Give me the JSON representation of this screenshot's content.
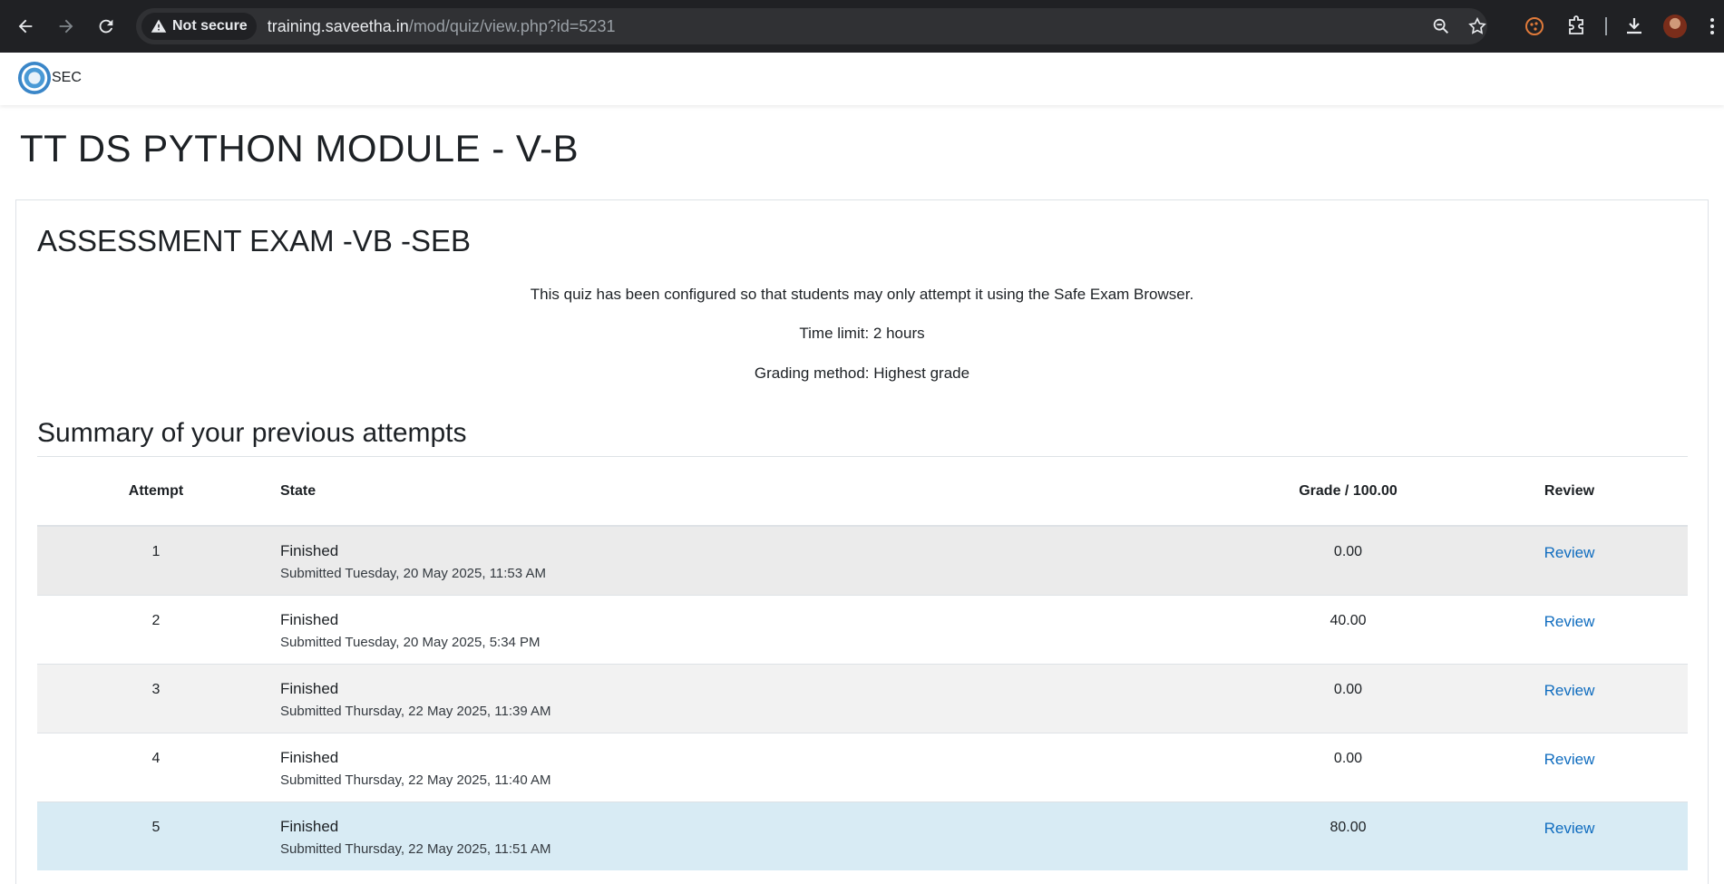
{
  "browser": {
    "security_label": "Not secure",
    "url_host": "training.saveetha.in",
    "url_path": "/mod/quiz/view.php?id=5231"
  },
  "site": {
    "brand": "SEC"
  },
  "page": {
    "course_title": "TT DS PYTHON MODULE - V-B",
    "quiz_title": "ASSESSMENT EXAM -VB -SEB",
    "info_seb": "This quiz has been configured so that students may only attempt it using the Safe Exam Browser.",
    "info_time": "Time limit: 2 hours",
    "info_grading": "Grading method: Highest grade",
    "summary_title": "Summary of your previous attempts"
  },
  "table": {
    "headers": {
      "attempt": "Attempt",
      "state": "State",
      "grade": "Grade / 100.00",
      "review": "Review"
    },
    "rows": [
      {
        "attempt": "1",
        "state": "Finished",
        "submitted": "Submitted Tuesday, 20 May 2025, 11:53 AM",
        "grade": "0.00",
        "review": "Review"
      },
      {
        "attempt": "2",
        "state": "Finished",
        "submitted": "Submitted Tuesday, 20 May 2025, 5:34 PM",
        "grade": "40.00",
        "review": "Review"
      },
      {
        "attempt": "3",
        "state": "Finished",
        "submitted": "Submitted Thursday, 22 May 2025, 11:39 AM",
        "grade": "0.00",
        "review": "Review"
      },
      {
        "attempt": "4",
        "state": "Finished",
        "submitted": "Submitted Thursday, 22 May 2025, 11:40 AM",
        "grade": "0.00",
        "review": "Review"
      },
      {
        "attempt": "5",
        "state": "Finished",
        "submitted": "Submitted Thursday, 22 May 2025, 11:51 AM",
        "grade": "80.00",
        "review": "Review"
      }
    ]
  },
  "colors": {
    "link": "#0f6cbf",
    "highlight_row": "#d8ebf4",
    "chrome_bg": "#202124"
  },
  "icons": [
    "back-icon",
    "forward-icon",
    "reload-icon",
    "warning-icon",
    "zoom-icon",
    "star-icon",
    "extension-puzzle-icon",
    "cookie-extension-icon",
    "download-icon",
    "menu-dots-icon"
  ]
}
